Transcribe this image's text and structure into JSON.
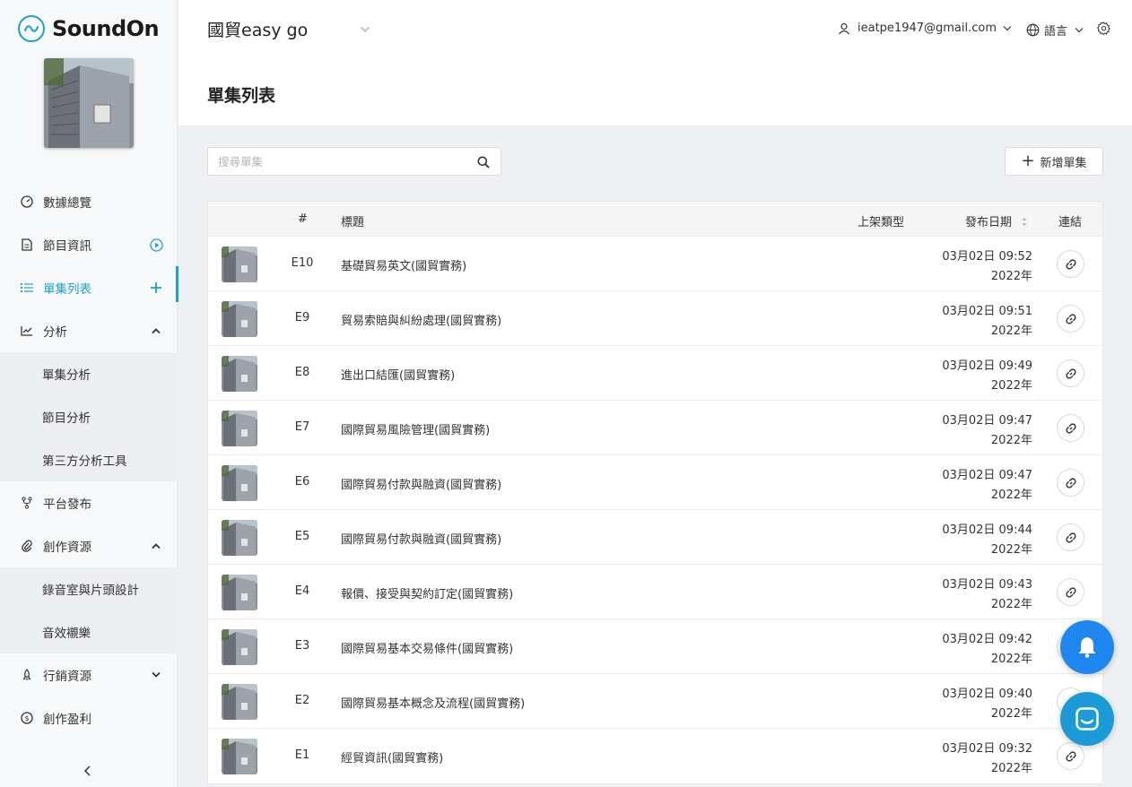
{
  "brand": {
    "name": "SoundOn",
    "accent": "#1aa3c6"
  },
  "sidebar": {
    "items": [
      {
        "label": "數據總覽",
        "icon": "dashboard-icon"
      },
      {
        "label": "節目資訊",
        "icon": "document-icon",
        "right_icon": "play-circle-icon"
      },
      {
        "label": "單集列表",
        "icon": "list-icon",
        "right_icon": "plus-icon",
        "active": true
      },
      {
        "label": "分析",
        "icon": "chart-icon",
        "right_icon": "chevron-up-icon"
      },
      {
        "label": "單集分析",
        "sub": true
      },
      {
        "label": "節目分析",
        "sub": true
      },
      {
        "label": "第三方分析工具",
        "sub": true
      },
      {
        "label": "平台發布",
        "icon": "distribute-icon"
      },
      {
        "label": "創作資源",
        "icon": "paperclip-icon",
        "right_icon": "chevron-up-icon"
      },
      {
        "label": "錄音室與片頭設計",
        "sub": true
      },
      {
        "label": "音效襯樂",
        "sub": true
      },
      {
        "label": "行銷資源",
        "icon": "rocket-icon",
        "right_icon": "chevron-down-icon"
      },
      {
        "label": "創作盈利",
        "icon": "dollar-icon"
      }
    ]
  },
  "header": {
    "show_name": "國貿easy go",
    "user_email": "ieatpe1947@gmail.com",
    "language_label": "語言",
    "page_title": "單集列表"
  },
  "toolbar": {
    "search_placeholder": "搜尋單集",
    "add_label": "新增單集"
  },
  "table": {
    "columns": {
      "num": "#",
      "title": "標題",
      "type": "上架類型",
      "date": "發布日期",
      "link": "連結"
    },
    "rows": [
      {
        "ep": "E10",
        "title": "基礎貿易英文(國貿實務)",
        "date": "03月02日 09:52",
        "year": "2022年"
      },
      {
        "ep": "E9",
        "title": "貿易索賠與糾紛處理(國貿實務)",
        "date": "03月02日 09:51",
        "year": "2022年"
      },
      {
        "ep": "E8",
        "title": "進出口結匯(國貿實務)",
        "date": "03月02日 09:49",
        "year": "2022年"
      },
      {
        "ep": "E7",
        "title": "國際貿易風險管理(國貿實務)",
        "date": "03月02日 09:47",
        "year": "2022年"
      },
      {
        "ep": "E6",
        "title": "國際貿易付款與融資(國貿實務)",
        "date": "03月02日 09:47",
        "year": "2022年"
      },
      {
        "ep": "E5",
        "title": "國際貿易付款與融資(國貿實務)",
        "date": "03月02日 09:44",
        "year": "2022年"
      },
      {
        "ep": "E4",
        "title": "報價、接受與契約訂定(國貿實務)",
        "date": "03月02日 09:43",
        "year": "2022年"
      },
      {
        "ep": "E3",
        "title": "國際貿易基本交易條件(國貿實務)",
        "date": "03月02日 09:42",
        "year": "2022年"
      },
      {
        "ep": "E2",
        "title": "國際貿易基本概念及流程(國貿實務)",
        "date": "03月02日 09:40",
        "year": "2022年"
      },
      {
        "ep": "E1",
        "title": "經貿資訊(國貿實務)",
        "date": "03月02日 09:32",
        "year": "2022年"
      }
    ]
  }
}
